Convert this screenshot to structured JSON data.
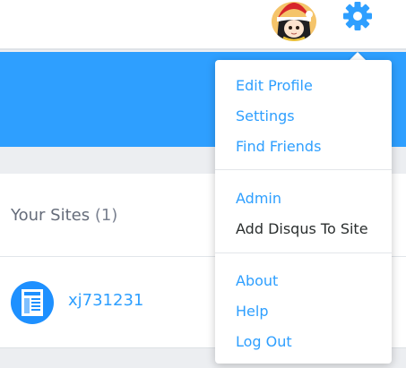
{
  "header": {
    "avatar_icon": "user-avatar-icon",
    "settings_icon": "gear-icon",
    "accent_color": "#2e9fff"
  },
  "sites": {
    "title": "Your Sites",
    "count": "(1)",
    "items": [
      {
        "name": "xj731231",
        "icon": "site-icon"
      }
    ]
  },
  "menu": {
    "groups": [
      [
        {
          "label": "Edit Profile"
        },
        {
          "label": "Settings"
        },
        {
          "label": "Find Friends"
        }
      ],
      [
        {
          "label": "Admin"
        },
        {
          "label": "Add Disqus To Site"
        }
      ],
      [
        {
          "label": "About"
        },
        {
          "label": "Help"
        },
        {
          "label": "Log Out"
        }
      ]
    ]
  }
}
